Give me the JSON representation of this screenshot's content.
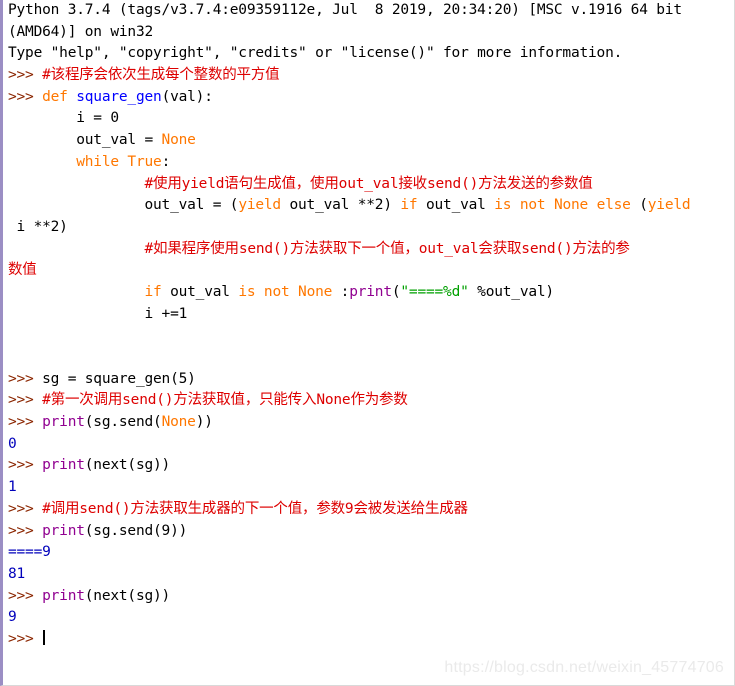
{
  "window": {
    "title": "Python 3.7.4 Shell",
    "border_color": "#9b8ec4",
    "background": "#ffffff"
  },
  "colors": {
    "prompt": "#8b2500",
    "comment": "#dd0000",
    "keyword": "#ff7700",
    "definition": "#0000ff",
    "builtin": "#900090",
    "string": "#00a000",
    "output": "#0000bb",
    "text": "#000000"
  },
  "watermark": {
    "text": "https://blog.csdn.net/weixin_45774706"
  },
  "cursor": {
    "visible": true
  },
  "shell": {
    "prompt": ">>> ",
    "lines": [
      {
        "name": "banner-line-1",
        "segments": [
          {
            "cls": "tok-plain",
            "text": "Python 3.7.4 (tags/v3.7.4:e09359112e, Jul  8 2019, 20:34:20) [MSC v.1916 64 bit"
          }
        ]
      },
      {
        "name": "banner-line-2",
        "segments": [
          {
            "cls": "tok-plain",
            "text": "(AMD64)] on win32"
          }
        ]
      },
      {
        "name": "banner-line-3",
        "segments": [
          {
            "cls": "tok-plain",
            "text": "Type \"help\", \"copyright\", \"credits\" or \"license()\" for more information."
          }
        ]
      },
      {
        "name": "input-comment-intro",
        "segments": [
          {
            "cls": "tok-prompt",
            "text": ">>> "
          },
          {
            "cls": "tok-comment",
            "text": "#该程序会依次生成每个整数的平方值"
          }
        ]
      },
      {
        "name": "input-def-square-gen",
        "segments": [
          {
            "cls": "tok-prompt",
            "text": ">>> "
          },
          {
            "cls": "tok-keyword",
            "text": "def"
          },
          {
            "cls": "tok-plain",
            "text": " "
          },
          {
            "cls": "tok-defname",
            "text": "square_gen"
          },
          {
            "cls": "tok-plain",
            "text": "(val):"
          }
        ]
      },
      {
        "name": "input-i-init",
        "segments": [
          {
            "cls": "tok-plain",
            "text": "        i = 0"
          }
        ]
      },
      {
        "name": "input-outval-init",
        "segments": [
          {
            "cls": "tok-plain",
            "text": "        out_val = "
          },
          {
            "cls": "tok-keyword",
            "text": "None"
          }
        ]
      },
      {
        "name": "input-while-true",
        "segments": [
          {
            "cls": "tok-plain",
            "text": "        "
          },
          {
            "cls": "tok-keyword",
            "text": "while True"
          },
          {
            "cls": "tok-plain",
            "text": ":"
          }
        ]
      },
      {
        "name": "input-comment-yield",
        "segments": [
          {
            "cls": "tok-plain",
            "text": "                "
          },
          {
            "cls": "tok-comment",
            "text": "#使用yield语句生成值，使用out_val接收send()方法发送的参数值"
          }
        ]
      },
      {
        "name": "input-yield-expression",
        "segments": [
          {
            "cls": "tok-plain",
            "text": "                out_val = ("
          },
          {
            "cls": "tok-keyword",
            "text": "yield"
          },
          {
            "cls": "tok-plain",
            "text": " out_val **2) "
          },
          {
            "cls": "tok-keyword",
            "text": "if"
          },
          {
            "cls": "tok-plain",
            "text": " out_val "
          },
          {
            "cls": "tok-keyword",
            "text": "is not None else"
          },
          {
            "cls": "tok-plain",
            "text": " ("
          },
          {
            "cls": "tok-keyword",
            "text": "yield"
          }
        ]
      },
      {
        "name": "input-yield-expression-wrap",
        "segments": [
          {
            "cls": "tok-plain",
            "text": " i **2)"
          }
        ]
      },
      {
        "name": "input-comment-send",
        "segments": [
          {
            "cls": "tok-plain",
            "text": "                "
          },
          {
            "cls": "tok-comment",
            "text": "#如果程序使用send()方法获取下一个值，out_val会获取send()方法的参"
          }
        ]
      },
      {
        "name": "input-comment-send-wrap",
        "segments": [
          {
            "cls": "tok-comment",
            "text": "数值"
          }
        ]
      },
      {
        "name": "input-if-print",
        "segments": [
          {
            "cls": "tok-plain",
            "text": "                "
          },
          {
            "cls": "tok-keyword",
            "text": "if"
          },
          {
            "cls": "tok-plain",
            "text": " out_val "
          },
          {
            "cls": "tok-keyword",
            "text": "is not None"
          },
          {
            "cls": "tok-plain",
            "text": " :"
          },
          {
            "cls": "tok-builtin",
            "text": "print"
          },
          {
            "cls": "tok-plain",
            "text": "("
          },
          {
            "cls": "tok-string",
            "text": "\"====%d\""
          },
          {
            "cls": "tok-plain",
            "text": " %out_val)"
          }
        ]
      },
      {
        "name": "input-i-increment",
        "segments": [
          {
            "cls": "tok-plain",
            "text": "                i +=1"
          }
        ]
      },
      {
        "name": "blank-line-1",
        "segments": [
          {
            "cls": "tok-plain",
            "text": ""
          }
        ]
      },
      {
        "name": "blank-line-2",
        "segments": [
          {
            "cls": "tok-plain",
            "text": ""
          }
        ]
      },
      {
        "name": "input-sg-assign",
        "segments": [
          {
            "cls": "tok-prompt",
            "text": ">>> "
          },
          {
            "cls": "tok-plain",
            "text": "sg = square_gen(5)"
          }
        ]
      },
      {
        "name": "input-comment-first-send",
        "segments": [
          {
            "cls": "tok-prompt",
            "text": ">>> "
          },
          {
            "cls": "tok-comment",
            "text": "#第一次调用send()方法获取值，只能传入None作为参数"
          }
        ]
      },
      {
        "name": "input-print-send-none",
        "segments": [
          {
            "cls": "tok-prompt",
            "text": ">>> "
          },
          {
            "cls": "tok-builtin",
            "text": "print"
          },
          {
            "cls": "tok-plain",
            "text": "(sg.send("
          },
          {
            "cls": "tok-keyword",
            "text": "None"
          },
          {
            "cls": "tok-plain",
            "text": "))"
          }
        ]
      },
      {
        "name": "output-zero",
        "segments": [
          {
            "cls": "tok-output",
            "text": "0"
          }
        ]
      },
      {
        "name": "input-print-next-1",
        "segments": [
          {
            "cls": "tok-prompt",
            "text": ">>> "
          },
          {
            "cls": "tok-builtin",
            "text": "print"
          },
          {
            "cls": "tok-plain",
            "text": "(next(sg))"
          }
        ]
      },
      {
        "name": "output-one",
        "segments": [
          {
            "cls": "tok-output",
            "text": "1"
          }
        ]
      },
      {
        "name": "input-comment-send-nine",
        "segments": [
          {
            "cls": "tok-prompt",
            "text": ">>> "
          },
          {
            "cls": "tok-comment",
            "text": "#调用send()方法获取生成器的下一个值，参数9会被发送给生成器"
          }
        ]
      },
      {
        "name": "input-print-send-nine",
        "segments": [
          {
            "cls": "tok-prompt",
            "text": ">>> "
          },
          {
            "cls": "tok-builtin",
            "text": "print"
          },
          {
            "cls": "tok-plain",
            "text": "(sg.send(9))"
          }
        ]
      },
      {
        "name": "output-equals-nine",
        "segments": [
          {
            "cls": "tok-output",
            "text": "====9"
          }
        ]
      },
      {
        "name": "output-eightyone",
        "segments": [
          {
            "cls": "tok-output",
            "text": "81"
          }
        ]
      },
      {
        "name": "input-print-next-2",
        "segments": [
          {
            "cls": "tok-prompt",
            "text": ">>> "
          },
          {
            "cls": "tok-builtin",
            "text": "print"
          },
          {
            "cls": "tok-plain",
            "text": "(next(sg))"
          }
        ]
      },
      {
        "name": "output-nine",
        "segments": [
          {
            "cls": "tok-output",
            "text": "9"
          }
        ]
      },
      {
        "name": "input-active-prompt",
        "segments": [
          {
            "cls": "tok-prompt",
            "text": ">>> "
          },
          {
            "cls": "cursor-slot",
            "text": ""
          }
        ]
      }
    ]
  }
}
